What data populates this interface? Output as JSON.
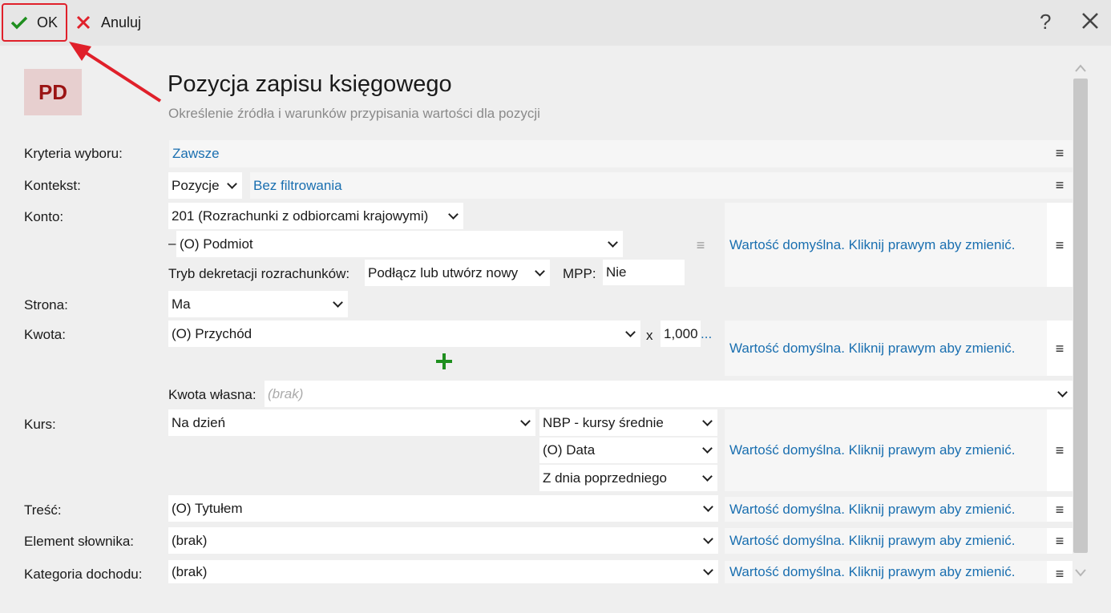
{
  "toolbar": {
    "ok_label": "OK",
    "cancel_label": "Anuluj",
    "help_label": "?"
  },
  "header": {
    "badge": "PD",
    "title": "Pozycja zapisu księgowego",
    "subtitle": "Określenie źródła i warunków przypisania wartości dla pozycji"
  },
  "form": {
    "kryteria": {
      "label": "Kryteria wyboru:",
      "value": "Zawsze"
    },
    "kontekst": {
      "label": "Kontekst:",
      "select": "Pozycje",
      "filter": "Bez filtrowania"
    },
    "konto": {
      "label": "Konto:",
      "account": "201 (Rozrachunki z odbiorcami krajowymi)",
      "dash": "–",
      "subject": "(O) Podmiot",
      "tryb_label": "Tryb dekretacji rozrachunków:",
      "tryb_value": "Podłącz lub utwórz nowy",
      "mpp_label": "MPP:",
      "mpp_value": "Nie"
    },
    "strona": {
      "label": "Strona:",
      "value": "Ma"
    },
    "kwota": {
      "label": "Kwota:",
      "value": "(O) Przychód",
      "x_label": "x",
      "multiplier": "1,000",
      "ellipsis": "..."
    },
    "kwota_wlasna": {
      "label": "Kwota własna:",
      "placeholder": "(brak)"
    },
    "kurs": {
      "label": "Kurs:",
      "type": "Na dzień",
      "table": "NBP - kursy średnie",
      "date": "(O) Data",
      "day": "Z dnia poprzedniego"
    },
    "tresc": {
      "label": "Treść:",
      "value": "(O) Tytułem"
    },
    "element": {
      "label": "Element słownika:",
      "value": "(brak)"
    },
    "kategoria": {
      "label": "Kategoria dochodu:",
      "value": "(brak)"
    },
    "default_text": "Wartość domyślna. Kliknij prawym aby zmienić.",
    "menu_glyph": "≡"
  },
  "colors": {
    "accent": "#1a6fb0",
    "badge_bg": "#e7cfcf",
    "badge_fg": "#9b1414",
    "highlight": "#e0202a",
    "ok_check": "#1f8f1f",
    "cancel_x": "#e0202a",
    "plus": "#1f8f1f"
  }
}
